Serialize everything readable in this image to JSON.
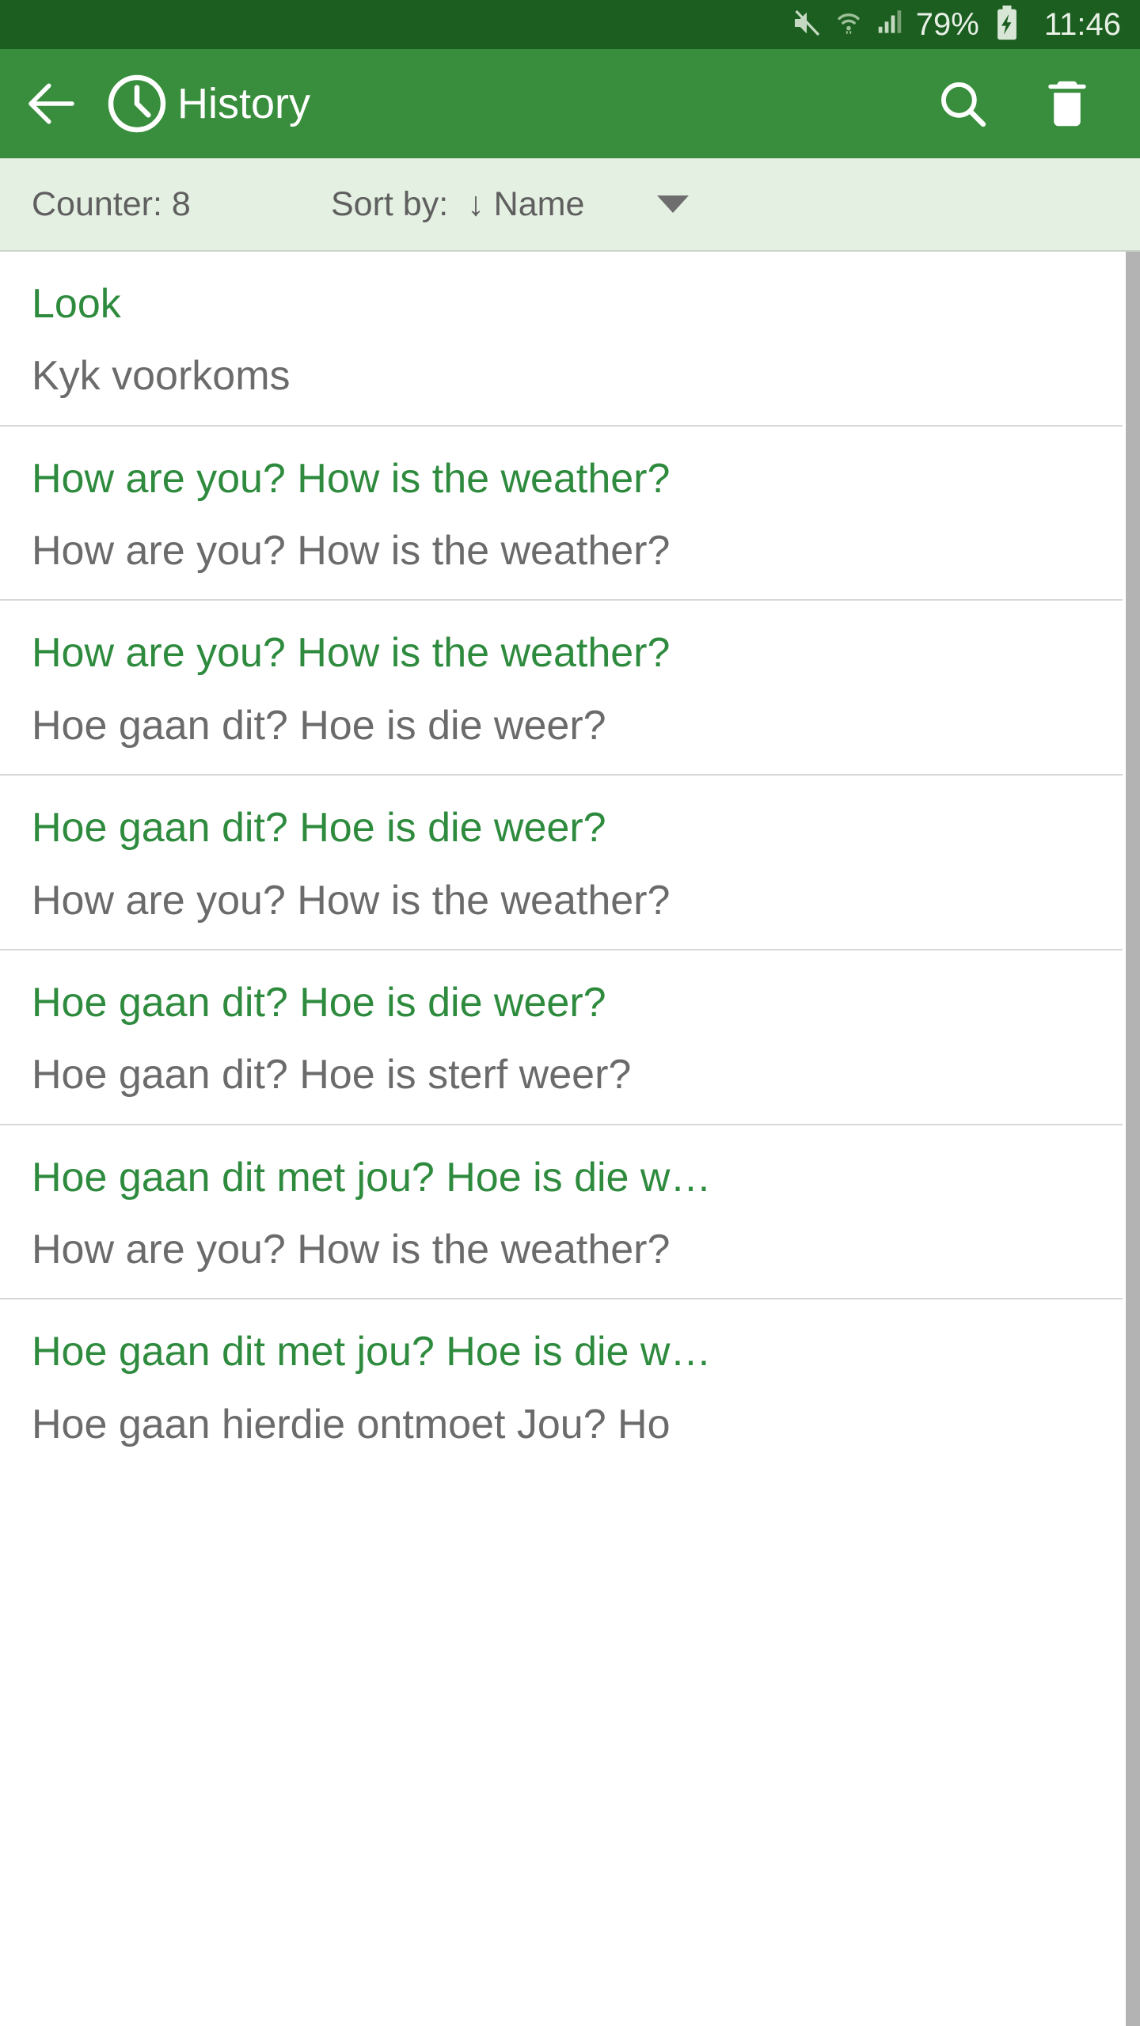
{
  "statusbar": {
    "icons": [
      "mute-icon",
      "wifi-icon",
      "signal-icon"
    ],
    "battery_percent": "79%",
    "battery_state": "charging",
    "time": "11:46",
    "background_color": "#1B5E20",
    "foreground_color": "#E8F0E6"
  },
  "appbar": {
    "back_label": "←",
    "icon": "clock-icon",
    "title": "History",
    "search_label": "search-icon",
    "delete_label": "delete-icon",
    "background_color": "#388E3C",
    "foreground_color": "#FFFFFF"
  },
  "sortbar": {
    "counter_label": "Counter: 8",
    "sort_by_label": "Sort by:",
    "sort_direction": "↓",
    "sort_value": "Name",
    "caret": "chevron-down-icon",
    "background_color": "#E4F0E2",
    "text_color": "#5F5F5F"
  },
  "list": {
    "source_color": "#2E8B3E",
    "target_color": "#6B6B6B",
    "items": [
      {
        "source": "Look",
        "target": "Kyk  voorkoms"
      },
      {
        "source": "How are you? How is the weather?",
        "target": "How are you? How is the weather?"
      },
      {
        "source": "How are you? How is the weather?",
        "target": "Hoe gaan dit? Hoe is die weer?"
      },
      {
        "source": "Hoe gaan dit? Hoe is die weer?",
        "target": "How are you? How is the weather?"
      },
      {
        "source": "Hoe gaan dit? Hoe is die weer?",
        "target": "Hoe gaan dit? Hoe is sterf weer?"
      },
      {
        "source": "Hoe gaan dit met jou? Hoe is die w…",
        "target": "How are you? How is the weather?"
      },
      {
        "source": "Hoe gaan dit met jou? Hoe is die w…",
        "target": "Hoe gaan hierdie ontmoet  Jou? Ho"
      }
    ]
  }
}
